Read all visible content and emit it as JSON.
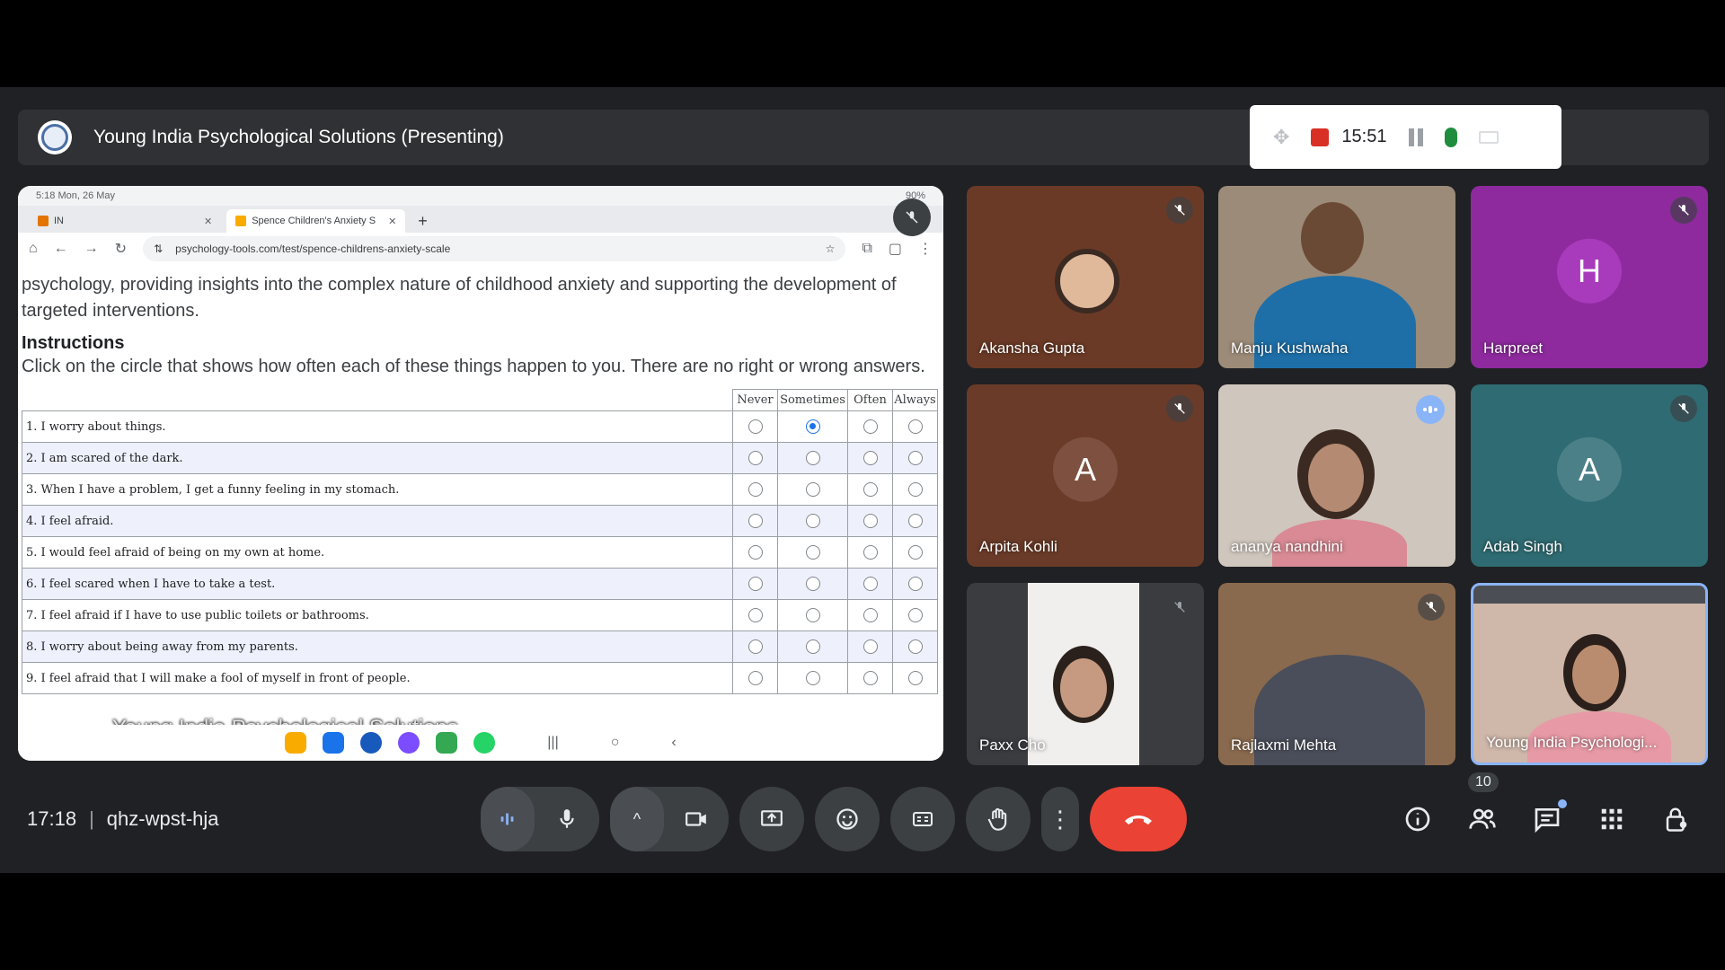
{
  "presentation": {
    "title": "Young India Psychological Solutions (Presenting)"
  },
  "recording": {
    "time": "15:51"
  },
  "shared_screen": {
    "status_time": "5:18  Mon, 26 May",
    "status_right": "90%",
    "tabs": [
      {
        "label": "IN"
      },
      {
        "label": "Spence Children's Anxiety S"
      }
    ],
    "url": "psychology-tools.com/test/spence-childrens-anxiety-scale",
    "intro": "psychology, providing insights into the complex nature of childhood anxiety and supporting the development of targeted interventions.",
    "instructions_heading": "Instructions",
    "instructions": "Click on the circle that shows how often each of these things happen to you. There are no right or wrong answers.",
    "columns": [
      "Never",
      "Sometimes",
      "Often",
      "Always"
    ],
    "questions": [
      {
        "text": "1. I worry about things.",
        "selected": 1
      },
      {
        "text": "2. I am scared of the dark.",
        "selected": -1
      },
      {
        "text": "3. When I have a problem, I get a funny feeling in my stomach.",
        "selected": -1
      },
      {
        "text": "4. I feel afraid.",
        "selected": -1
      },
      {
        "text": "5. I would feel afraid of being on my own at home.",
        "selected": -1
      },
      {
        "text": "6. I feel scared when I have to take a test.",
        "selected": -1
      },
      {
        "text": "7. I feel afraid if I have to use public toilets or bathrooms.",
        "selected": -1
      },
      {
        "text": "8. I worry about being away from my parents.",
        "selected": -1
      },
      {
        "text": "9. I feel afraid that I will make a fool of myself in front of people.",
        "selected": -1
      }
    ],
    "watermark": "Young India Psychological Solutions"
  },
  "participants": [
    {
      "name": "Akansha Gupta",
      "muted": true,
      "bg": "#6b3a26"
    },
    {
      "name": "Manju Kushwaha",
      "muted": false,
      "bg": "#9c8b78"
    },
    {
      "name": "Harpreet",
      "muted": true,
      "initial": "H",
      "bg": "#8e2a9e",
      "avatar_color": "#a83bbb"
    },
    {
      "name": "Arpita Kohli",
      "muted": true,
      "initial": "A",
      "bg": "#6a3b28",
      "avatar_color": "#7d5040"
    },
    {
      "name": "ananya nandhini",
      "speaking": true,
      "bg": "#cfc6bd"
    },
    {
      "name": "Adab Singh",
      "muted": true,
      "initial": "A",
      "bg": "#2f6b72",
      "avatar_color": "#4c8088"
    },
    {
      "name": "Paxx Cho",
      "muted": true,
      "bg": "#3a3c40"
    },
    {
      "name": "Rajlaxmi Mehta",
      "muted": true,
      "bg": "#8a6a4e"
    },
    {
      "name": "Young India Psychologi...",
      "muted": false,
      "bg": "#cfb7aa"
    }
  ],
  "meeting": {
    "time": "17:18",
    "code": "qhz-wpst-hja",
    "participant_count": "10"
  },
  "colors": {
    "end_call": "#ea4335",
    "accent": "#8ab4f8",
    "recording": "#d93025"
  }
}
